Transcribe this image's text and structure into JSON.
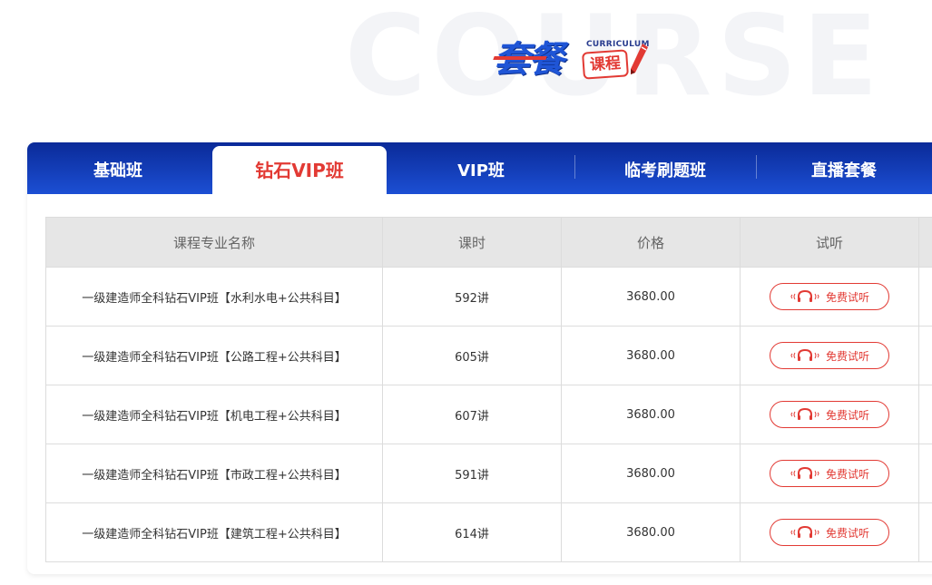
{
  "hero": {
    "background_word": "COURSE",
    "logo_main": "套餐",
    "logo_en": "CURRICULUM",
    "logo_badge": "课程"
  },
  "tabs": [
    {
      "label": "基础班",
      "active": false
    },
    {
      "label": "钻石VIP班",
      "active": true
    },
    {
      "label": "VIP班",
      "active": false
    },
    {
      "label": "临考刷题班",
      "active": false
    },
    {
      "label": "直播套餐",
      "active": false
    }
  ],
  "table": {
    "headers": [
      "课程专业名称",
      "课时",
      "价格",
      "试听"
    ],
    "rows": [
      {
        "name": "一级建造师全科钻石VIP班【水利水电+公共科目】",
        "hours": "592讲",
        "price": "3680.00",
        "trial": "免费试听"
      },
      {
        "name": "一级建造师全科钻石VIP班【公路工程+公共科目】",
        "hours": "605讲",
        "price": "3680.00",
        "trial": "免费试听"
      },
      {
        "name": "一级建造师全科钻石VIP班【机电工程+公共科目】",
        "hours": "607讲",
        "price": "3680.00",
        "trial": "免费试听"
      },
      {
        "name": "一级建造师全科钻石VIP班【市政工程+公共科目】",
        "hours": "591讲",
        "price": "3680.00",
        "trial": "免费试听"
      },
      {
        "name": "一级建造师全科钻石VIP班【建筑工程+公共科目】",
        "hours": "614讲",
        "price": "3680.00",
        "trial": "免费试听"
      }
    ]
  },
  "colors": {
    "accent_red": "#e23a34",
    "tab_blue": "#1c4fd4",
    "header_gray": "#e6e6e6"
  },
  "icons": {
    "trial": "headphones-icon",
    "logo": "pencil-icon"
  }
}
